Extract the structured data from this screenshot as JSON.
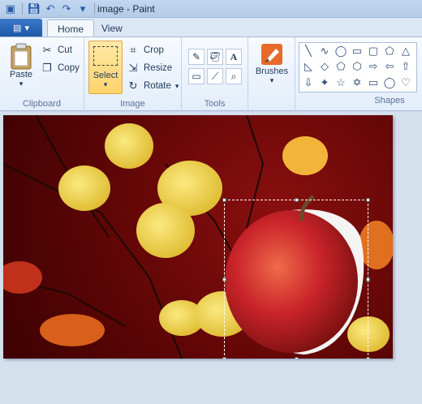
{
  "window": {
    "title": "image - Paint"
  },
  "tabs": {
    "file_label": "",
    "home": "Home",
    "view": "View"
  },
  "clipboard": {
    "paste": "Paste",
    "cut": "Cut",
    "copy": "Copy",
    "label": "Clipboard"
  },
  "image": {
    "select": "Select",
    "crop": "Crop",
    "resize": "Resize",
    "rotate": "Rotate",
    "label": "Image"
  },
  "tools": {
    "label": "Tools",
    "text_glyph": "A"
  },
  "brushes": {
    "label": "Brushes"
  },
  "shapes": {
    "label": "Shapes"
  },
  "colors": {
    "accent": "#2a5aa6",
    "canvas_bg": "#5a0505",
    "leaf": "#f0d24a",
    "apple": "#c9242a"
  }
}
